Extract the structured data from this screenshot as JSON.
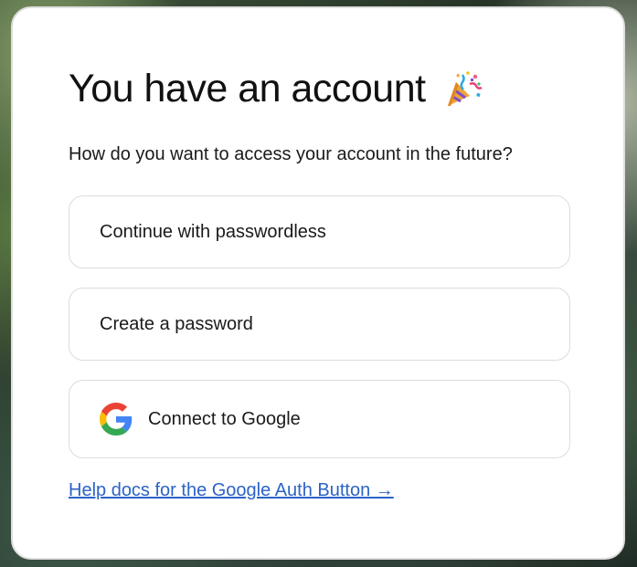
{
  "card": {
    "title": "You have an account",
    "title_icon": "party-popper-icon",
    "subtitle": "How do you want to access your account in the future?"
  },
  "options": [
    {
      "label": "Continue with passwordless"
    },
    {
      "label": "Create a password"
    },
    {
      "label": "Connect to Google",
      "icon": "google-icon"
    }
  ],
  "help": {
    "link_text": "Help docs for the Google Auth Button →"
  },
  "colors": {
    "link": "#2b63c7",
    "text": "#111111",
    "border": "#dcdcdc"
  }
}
